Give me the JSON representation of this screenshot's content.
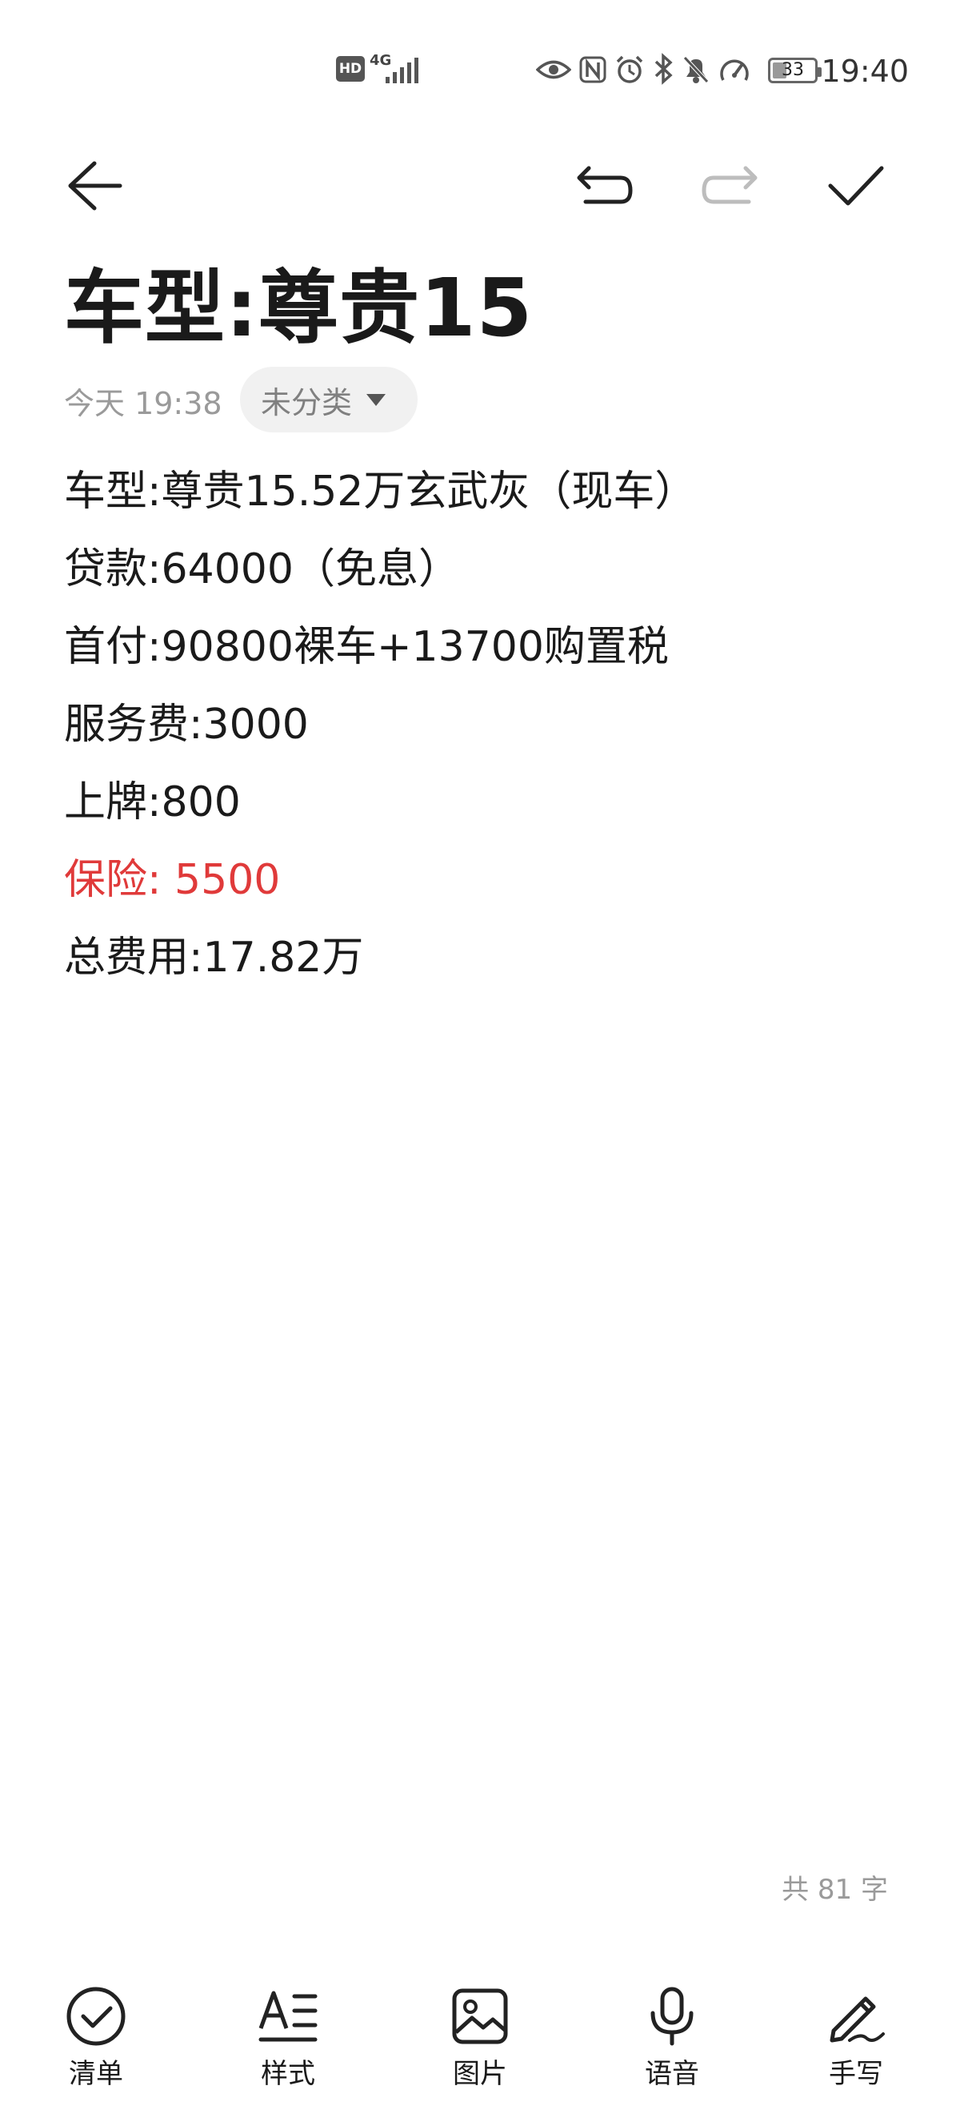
{
  "status_bar": {
    "hd_badge": "HD",
    "network": "4G",
    "battery": "33",
    "time": "19:40"
  },
  "toolbar": {
    "back_icon": "arrow-left-icon",
    "undo_icon": "undo-icon",
    "redo_icon": "redo-icon",
    "done_icon": "check-icon"
  },
  "note": {
    "title": "车型:尊贵15",
    "date": "今天 19:38",
    "category": "未分类",
    "lines": [
      {
        "text": "车型:尊贵15.52万玄武灰（现车）",
        "color": "#1a1a1a"
      },
      {
        "text": "贷款:64000（免息）",
        "color": "#1a1a1a"
      },
      {
        "text": "首付:90800裸车+13700购置税",
        "color": "#1a1a1a"
      },
      {
        "text": "服务费:3000",
        "color": "#1a1a1a"
      },
      {
        "text": "上牌:800",
        "color": "#1a1a1a"
      },
      {
        "text": "保险: 5500",
        "color": "#e03a3a"
      },
      {
        "text": "总费用:17.82万",
        "color": "#1a1a1a"
      }
    ],
    "word_count": "共 81 字"
  },
  "bottom_nav": {
    "items": [
      {
        "label": "清单",
        "icon": "checklist-icon"
      },
      {
        "label": "样式",
        "icon": "text-style-icon"
      },
      {
        "label": "图片",
        "icon": "image-icon"
      },
      {
        "label": "语音",
        "icon": "microphone-icon"
      },
      {
        "label": "手写",
        "icon": "handwriting-pen-icon"
      }
    ]
  }
}
